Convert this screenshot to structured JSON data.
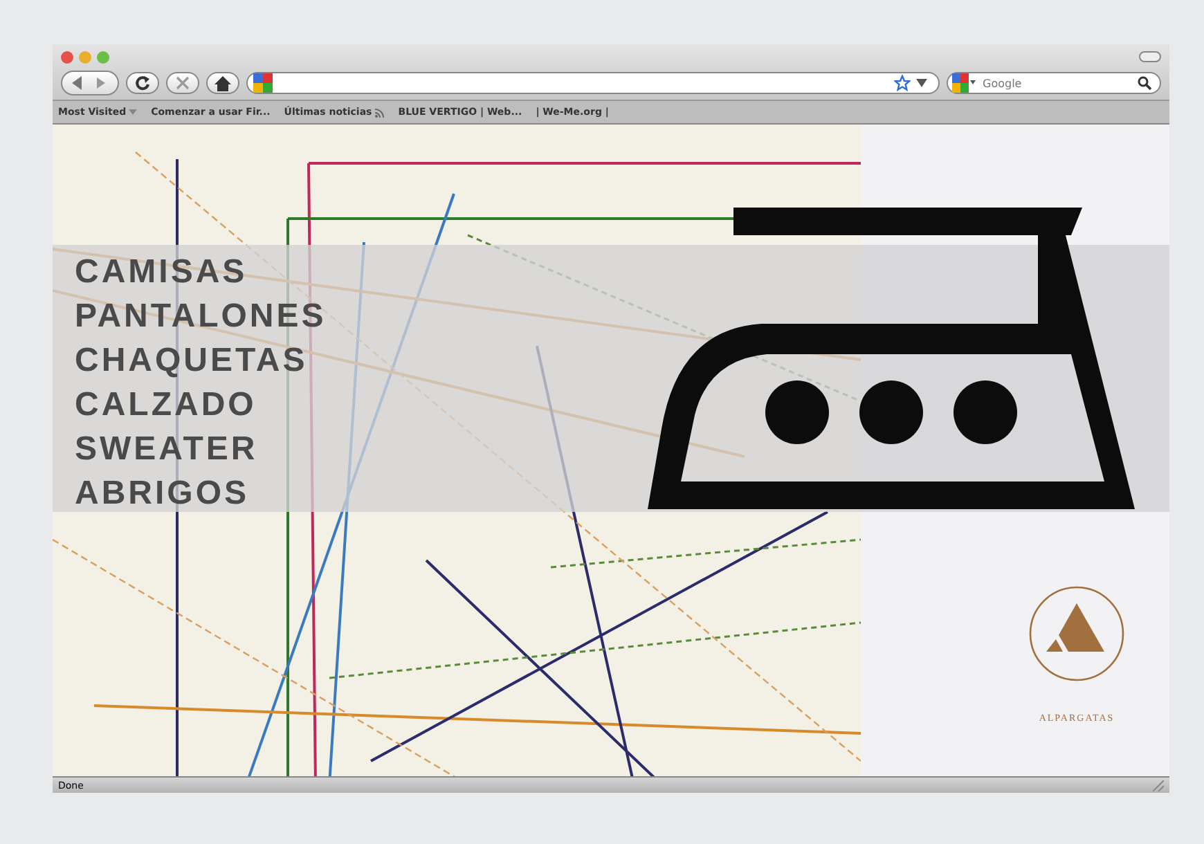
{
  "browser": {
    "search": {
      "placeholder": "Google"
    },
    "bookmarks": [
      {
        "label": "Most Visited",
        "kind": "menu"
      },
      {
        "label": "Comenzar a usar Fir...",
        "kind": "link"
      },
      {
        "label": "Últimas noticias",
        "kind": "feed"
      },
      {
        "label": "BLUE VERTIGO | Web...",
        "kind": "link"
      },
      {
        "label": "| We-Me.org |",
        "kind": "link"
      }
    ],
    "status": "Done"
  },
  "menu": [
    "CAMISAS",
    "PANTALONES",
    "CHAQUETAS",
    "CALZADO",
    "SWEATER",
    "ABRIGOS"
  ],
  "brand": "ALPARGATAS"
}
